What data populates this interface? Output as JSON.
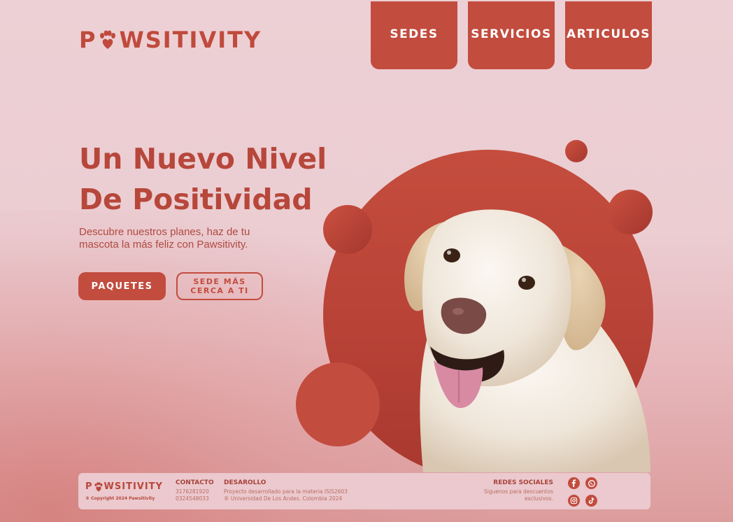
{
  "brand": {
    "name_before_paw": "P",
    "name_after_paw": "WSITIVITY"
  },
  "nav": {
    "items": [
      {
        "label": "SEDES"
      },
      {
        "label": "SERVICIOS"
      },
      {
        "label": "ARTICULOS"
      }
    ]
  },
  "hero": {
    "title_line1": "Un Nuevo Nivel",
    "title_line2": "De Positividad",
    "subtitle_line1": "Descubre nuestros planes, haz de tu",
    "subtitle_line2": "mascota la más feliz con Pawsitivity.",
    "cta_primary": "PAQUETES",
    "cta_secondary_line1": "SEDE MÁS",
    "cta_secondary_line2": "CERCA A TI"
  },
  "footer": {
    "brand_before_paw": "P",
    "brand_after_paw": "WSITIVITY",
    "copyright": "® Copyright 2024 Pawsitivity",
    "contact": {
      "heading": "CONTACTO",
      "phone1": "3176281920",
      "phone2": "0324548033"
    },
    "development": {
      "heading": "DESAROLLO",
      "line1": "Proyecto desarrollado para la materia ISIS2603",
      "line2": "® Universidad De Los Andes, Colombia 2024"
    },
    "social": {
      "heading": "REDES SOCIALES",
      "line1": "Siguenos para descuentos",
      "line2": "exclusivos.",
      "icons": [
        "facebook-icon",
        "whatsapp-icon",
        "instagram-icon",
        "tiktok-icon"
      ]
    }
  },
  "colors": {
    "accent": "#c24c3e",
    "background": "#ecd0d5"
  }
}
